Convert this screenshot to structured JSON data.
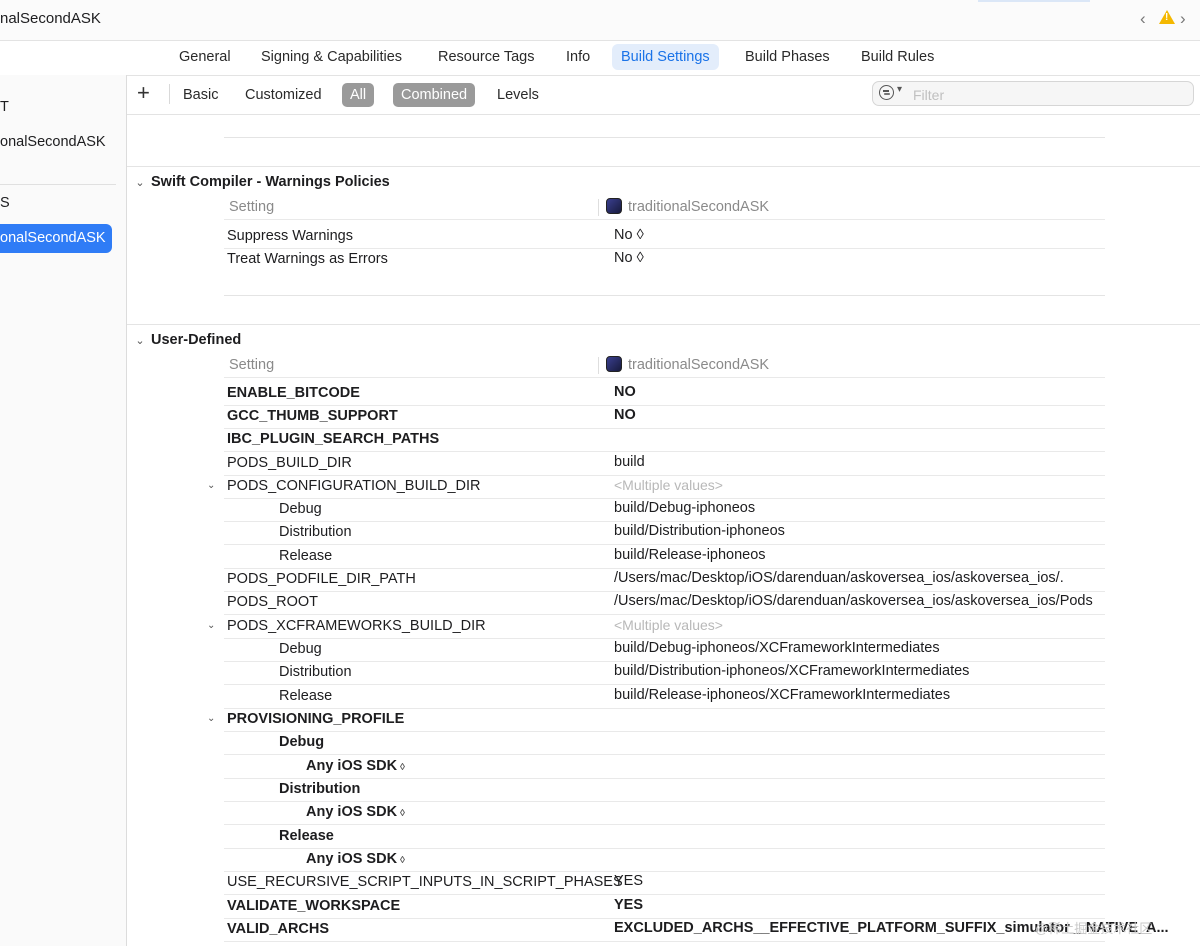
{
  "window": {
    "title": "nalSecondASK"
  },
  "tabs": [
    "General",
    "Signing & Capabilities",
    "Resource Tags",
    "Info",
    "Build Settings",
    "Build Phases",
    "Build Rules"
  ],
  "sidebar": {
    "section1_label": "T",
    "item1": "onalSecondASK",
    "section2_label": "S",
    "item2": "onalSecondASK"
  },
  "toolbar": {
    "add": "+",
    "filters": [
      "Basic",
      "Customized",
      "All",
      "Combined",
      "Levels"
    ],
    "filter_placeholder": "Filter"
  },
  "sections": [
    {
      "title": "Swift Compiler - Warnings Policies",
      "header": {
        "setting": "Setting",
        "target": "traditionalSecondASK"
      },
      "rows": [
        {
          "name": "Suppress Warnings",
          "value": "No ◊"
        },
        {
          "name": "Treat Warnings as Errors",
          "value": "No ◊"
        }
      ]
    },
    {
      "title": "User-Defined",
      "header": {
        "setting": "Setting",
        "target": "traditionalSecondASK"
      },
      "rows": [
        {
          "name": "ENABLE_BITCODE",
          "value": "NO"
        },
        {
          "name": "GCC_THUMB_SUPPORT",
          "value": "NO"
        },
        {
          "name": "IBC_PLUGIN_SEARCH_PATHS",
          "value": ""
        },
        {
          "name": "PODS_BUILD_DIR",
          "value": "build"
        },
        {
          "name": "PODS_CONFIGURATION_BUILD_DIR",
          "value": "<Multiple values>"
        },
        {
          "name": "Debug",
          "value": "build/Debug-iphoneos"
        },
        {
          "name": "Distribution",
          "value": "build/Distribution-iphoneos"
        },
        {
          "name": "Release",
          "value": "build/Release-iphoneos"
        },
        {
          "name": "PODS_PODFILE_DIR_PATH",
          "value": "/Users/mac/Desktop/iOS/darenduan/askoversea_ios/askoversea_ios/."
        },
        {
          "name": "PODS_ROOT",
          "value": "/Users/mac/Desktop/iOS/darenduan/askoversea_ios/askoversea_ios/Pods"
        },
        {
          "name": "PODS_XCFRAMEWORKS_BUILD_DIR",
          "value": "<Multiple values>"
        },
        {
          "name": "Debug",
          "value": "build/Debug-iphoneos/XCFrameworkIntermediates"
        },
        {
          "name": "Distribution",
          "value": "build/Distribution-iphoneos/XCFrameworkIntermediates"
        },
        {
          "name": "Release",
          "value": "build/Release-iphoneos/XCFrameworkIntermediates"
        },
        {
          "name": "PROVISIONING_PROFILE",
          "value": ""
        },
        {
          "name": "Debug",
          "value": ""
        },
        {
          "name": "Any iOS SDK",
          "value": ""
        },
        {
          "name": "Distribution",
          "value": ""
        },
        {
          "name": "Any iOS SDK",
          "value": ""
        },
        {
          "name": "Release",
          "value": ""
        },
        {
          "name": "Any iOS SDK",
          "value": ""
        },
        {
          "name": "USE_RECURSIVE_SCRIPT_INPUTS_IN_SCRIPT_PHASES",
          "value": "YES"
        },
        {
          "name": "VALIDATE_WORKSPACE",
          "value": "YES"
        },
        {
          "name": "VALID_ARCHS",
          "value": "EXCLUDED_ARCHS__EFFECTIVE_PLATFORM_SUFFIX_simulator__NATIVE_A..."
        }
      ]
    }
  ],
  "watermark": "@稀土掘金技术社区"
}
